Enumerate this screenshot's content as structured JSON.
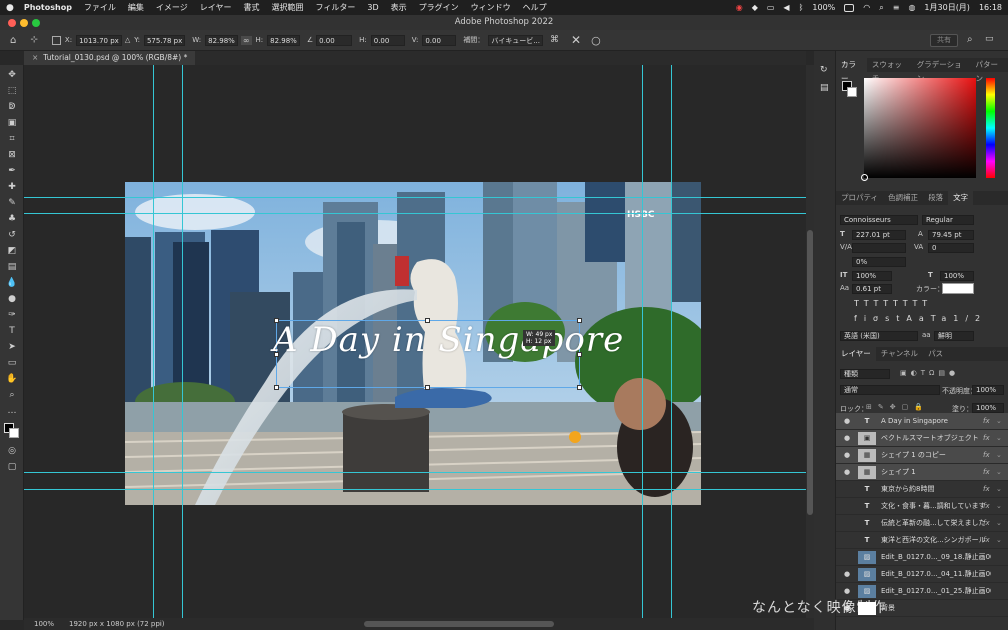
{
  "menubar": {
    "app": "Photoshop",
    "items": [
      "ファイル",
      "編集",
      "イメージ",
      "レイヤー",
      "書式",
      "選択範囲",
      "フィルター",
      "3D",
      "表示",
      "プラグイン",
      "ウィンドウ",
      "ヘルプ"
    ],
    "battery": "100%",
    "date": "1月30日(月)",
    "time": "16:18"
  },
  "titlebar": {
    "title": "Adobe Photoshop 2022"
  },
  "options": {
    "x_label": "X:",
    "x_value": "1013.70 px",
    "y_label": "Y:",
    "y_value": "575.78 px",
    "w_label": "W:",
    "w_value": "82.98%",
    "h_label": "H:",
    "h_value": "82.98%",
    "angle_value": "0.00",
    "h_skew_label": "H:",
    "h_skew_value": "0.00",
    "v_skew_label": "V:",
    "v_skew_value": "0.00",
    "interp_label": "補間：",
    "interp_value": "バイキュービ...",
    "share_label": "共有"
  },
  "document": {
    "tab_label": "Tutorial_0130.psd @ 100% (RGB/8#) *",
    "zoom": "100%",
    "doc_info": "1920 px x 1080 px (72 ppi)"
  },
  "artwork": {
    "title_text": "A Day in Singapore",
    "sign_text": "HSBC",
    "readout_w": "W: 49 px",
    "readout_h": "H: 12 px"
  },
  "color_panel": {
    "tabs": [
      "カラー",
      "スウォッチ",
      "グラデーション",
      "パターン"
    ]
  },
  "char_panel": {
    "tabs": [
      "プロパティ",
      "色調補正",
      "段落",
      "文字"
    ],
    "font_family": "Connoisseurs",
    "font_style": "Regular",
    "size": "227.01 pt",
    "leading": "79.45 pt",
    "kerning": "",
    "tracking": "0",
    "tsume": "0%",
    "vscale": "100%",
    "hscale": "100%",
    "baseline": "0.61 pt",
    "color_label": "カラー：",
    "language": "英語 (米国)",
    "aa_label": "aa",
    "aa_value": "鮮明"
  },
  "layers_panel": {
    "tabs": [
      "レイヤー",
      "チャンネル",
      "パス"
    ],
    "filter_value": "種類",
    "blend_mode": "通常",
    "opacity_label": "不透明度：",
    "opacity_value": "100%",
    "lock_label": "ロック：",
    "fill_label": "塗り：",
    "fill_value": "100%",
    "layers": [
      {
        "name": "A Day in Singapore",
        "kind": "T",
        "visible": "●",
        "fx": "fx"
      },
      {
        "name": "ベクトルスマートオブジェクト",
        "kind": "▣",
        "visible": "●",
        "fx": "fx"
      },
      {
        "name": "シェイプ 1 のコピー",
        "kind": "▦",
        "visible": "●",
        "fx": "fx"
      },
      {
        "name": "シェイプ 1",
        "kind": "▦",
        "visible": "●",
        "fx": "fx"
      },
      {
        "name": "東京から約8時間",
        "kind": "T",
        "visible": "",
        "fx": "fx"
      },
      {
        "name": "文化・食事・暮...調和しています",
        "kind": "T",
        "visible": "",
        "fx": "fx"
      },
      {
        "name": "伝統と革新の融...して栄えました",
        "kind": "T",
        "visible": "",
        "fx": "fx"
      },
      {
        "name": "東洋と西洋の文化...シンガポール",
        "kind": "T",
        "visible": "",
        "fx": "fx"
      },
      {
        "name": "Edit_B_0127.0..._09_18.静止画003",
        "kind": "▨",
        "visible": "",
        "fx": ""
      },
      {
        "name": "Edit_B_0127.0..._04_11.静止画002",
        "kind": "▨",
        "visible": "●",
        "fx": ""
      },
      {
        "name": "Edit_B_0127.0..._01_25.静止画001",
        "kind": "▨",
        "visible": "●",
        "fx": ""
      },
      {
        "name": "背景",
        "kind": "",
        "visible": "●",
        "fx": ""
      }
    ]
  },
  "watermark": "なんとなく映像制作",
  "colors": {
    "guide": "#35c6d4",
    "accent": "#ffffff",
    "panel": "#323232"
  }
}
